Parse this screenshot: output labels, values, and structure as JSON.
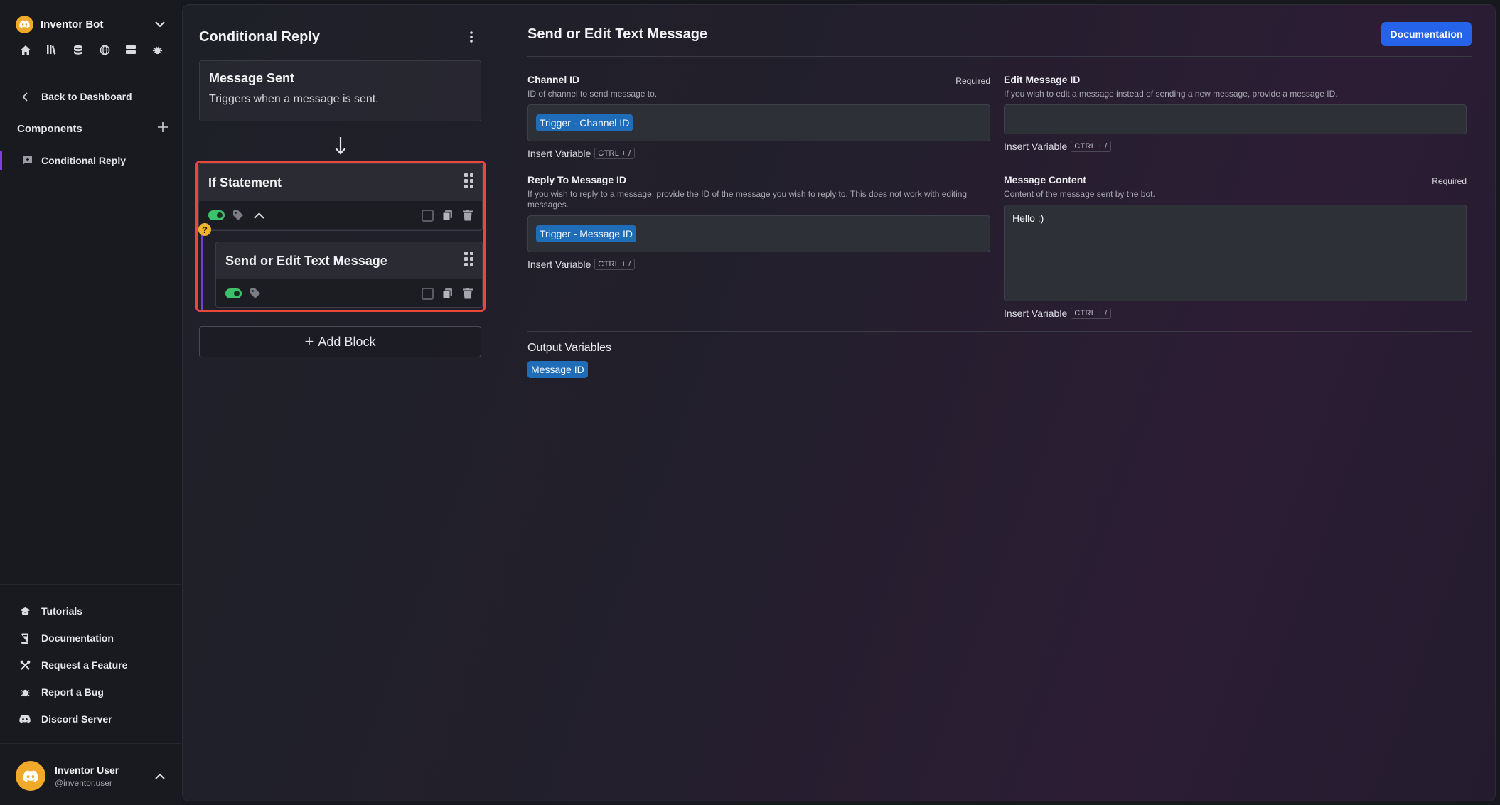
{
  "sidebar": {
    "bot_name": "Inventor Bot",
    "nav_icons": [
      "home-icon",
      "library-icon",
      "database-icon",
      "globe-icon",
      "server-icon",
      "bug-icon"
    ],
    "back_label": "Back to Dashboard",
    "components_label": "Components",
    "components": [
      {
        "label": "Conditional Reply",
        "icon": "message-plus-icon"
      }
    ],
    "bottom_links": [
      {
        "label": "Tutorials",
        "icon": "graduation-cap-icon"
      },
      {
        "label": "Documentation",
        "icon": "book-icon"
      },
      {
        "label": "Request a Feature",
        "icon": "tools-icon"
      },
      {
        "label": "Report a Bug",
        "icon": "bug-icon"
      },
      {
        "label": "Discord Server",
        "icon": "discord-icon"
      }
    ],
    "user": {
      "name": "Inventor User",
      "handle": "@inventor.user"
    }
  },
  "flow": {
    "title": "Conditional Reply",
    "trigger": {
      "title": "Message Sent",
      "description": "Triggers when a message is sent."
    },
    "blocks": [
      {
        "title": "If Statement",
        "enabled": true
      },
      {
        "title": "Send or Edit Text Message",
        "enabled": true
      }
    ],
    "question_badge": "?",
    "add_block_label": "Add Block"
  },
  "editor": {
    "title": "Send or Edit Text Message",
    "documentation_button": "Documentation",
    "insert_variable": "Insert Variable",
    "shortcut": "CTRL + /",
    "fields": {
      "channel_id": {
        "label": "Channel ID",
        "required": "Required",
        "description": "ID of channel to send message to.",
        "chip": "Trigger - Channel ID"
      },
      "edit_message_id": {
        "label": "Edit Message ID",
        "description": "If you wish to edit a message instead of sending a new message, provide a message ID."
      },
      "reply_to": {
        "label": "Reply To Message ID",
        "description": "If you wish to reply to a message, provide the ID of the message you wish to reply to. This does not work with editing messages.",
        "chip": "Trigger - Message ID"
      },
      "message_content": {
        "label": "Message Content",
        "required": "Required",
        "description": "Content of the message sent by the bot.",
        "value": "Hello :)"
      }
    },
    "output": {
      "title": "Output Variables",
      "chip": "Message ID"
    }
  },
  "colors": {
    "accent": "#2563eb",
    "chip": "#1f6cb8",
    "toggle_on": "#3cc26a",
    "highlight": "#e8473a",
    "nest_line": "#6e3fd0",
    "bot_avatar": "#f1a92a"
  }
}
